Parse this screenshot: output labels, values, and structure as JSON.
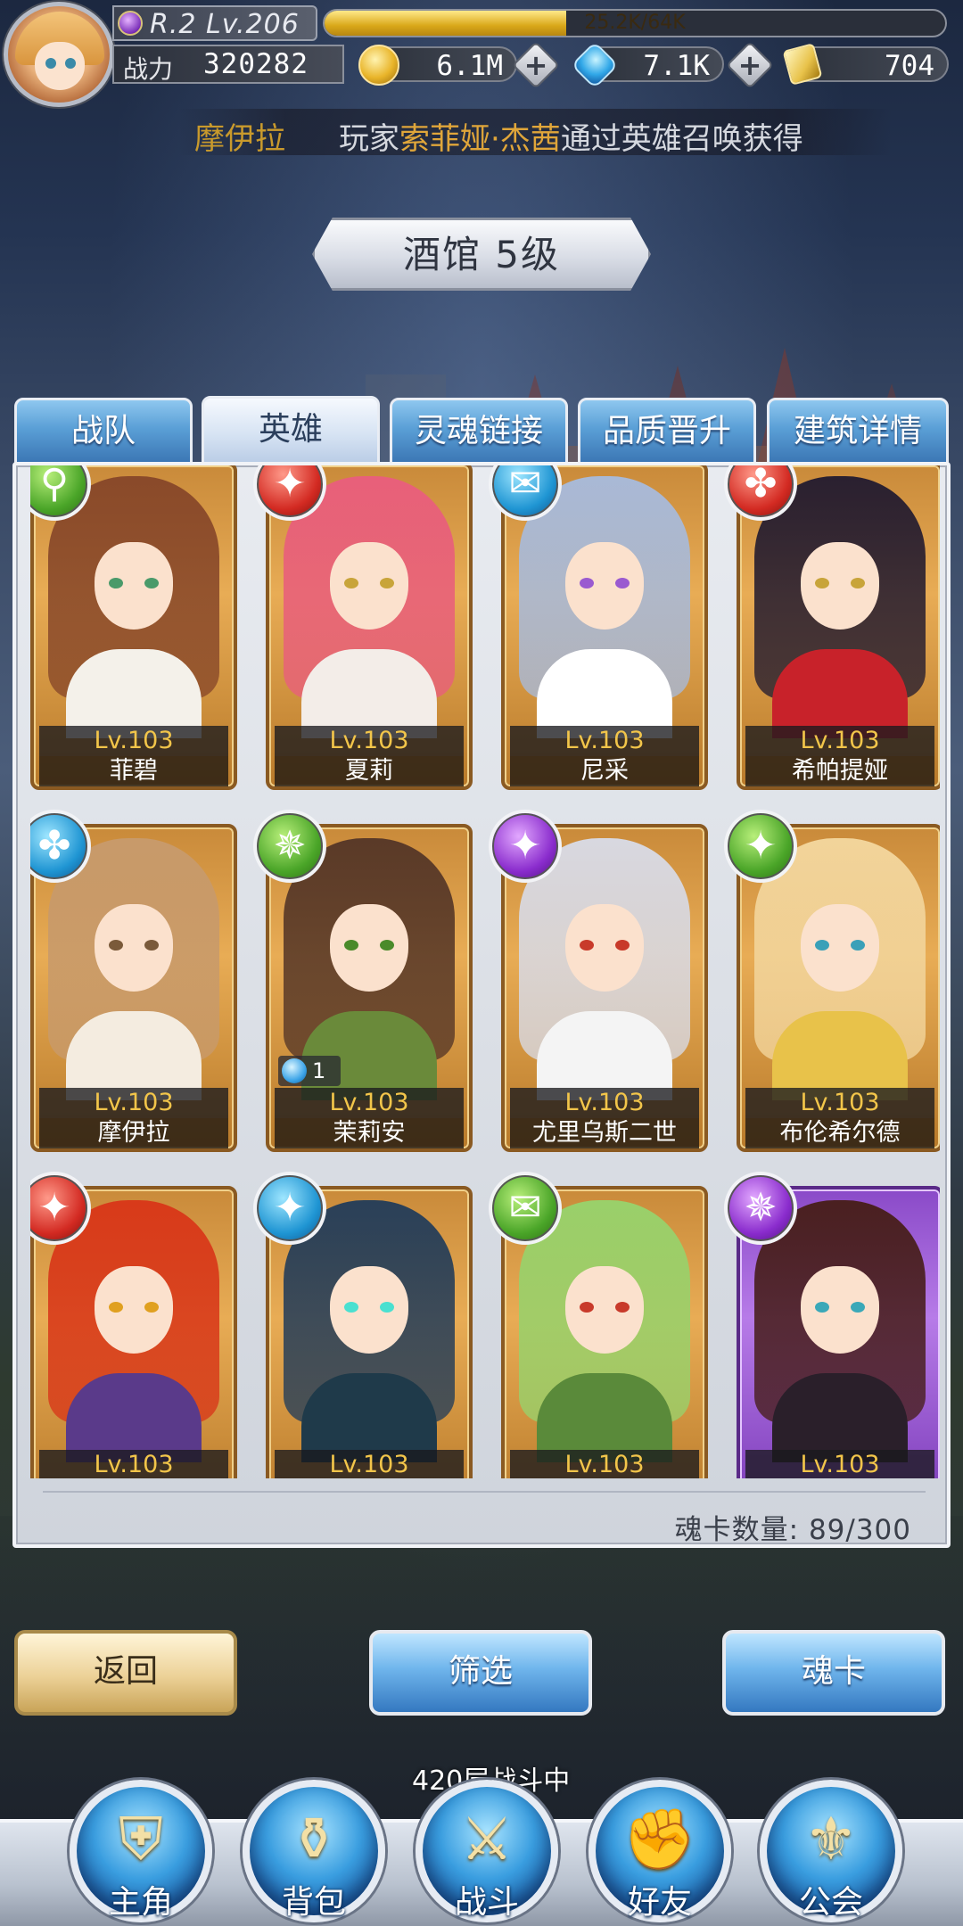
{
  "player": {
    "rank_level": "R.2 Lv.206",
    "exp_text": "25.2K/64K",
    "exp_fraction": 0.39,
    "power_label": "战力",
    "power_value": "320282"
  },
  "currencies": [
    {
      "icon": "gold-coin-icon",
      "value": "6.1M"
    },
    {
      "icon": "diamond-icon",
      "value": "7.1K"
    },
    {
      "icon": "ticket-icon",
      "value": "704"
    }
  ],
  "marquee": {
    "name": "摩伊拉",
    "text_prefix": "玩家",
    "text_highlight": "索菲娅·杰茜",
    "text_suffix": "通过英雄召唤获得"
  },
  "title": "酒馆 5级",
  "tabs": [
    "战队",
    "英雄",
    "灵魂链接",
    "品质晋升",
    "建筑详情"
  ],
  "active_tab": 1,
  "heroes": [
    {
      "name": "菲碧",
      "level": "Lv.103",
      "badge": "b-green",
      "badge_icon": "magic-staff-icon",
      "glyph": "⚲"
    },
    {
      "name": "夏莉",
      "level": "Lv.103",
      "badge": "b-red",
      "badge_icon": "sword-icon",
      "glyph": "✦"
    },
    {
      "name": "尼采",
      "level": "Lv.103",
      "badge": "b-blue",
      "badge_icon": "book-icon",
      "glyph": "✉"
    },
    {
      "name": "希帕提娅",
      "level": "Lv.103",
      "badge": "b-red",
      "badge_icon": "wings-icon",
      "glyph": "✤"
    },
    {
      "name": "摩伊拉",
      "level": "Lv.103",
      "badge": "b-blue",
      "badge_icon": "wings-icon",
      "glyph": "✤"
    },
    {
      "name": "茉莉安",
      "level": "Lv.103",
      "badge": "b-green",
      "badge_icon": "shuriken-icon",
      "glyph": "✵",
      "soul": "1"
    },
    {
      "name": "尤里乌斯二世",
      "level": "Lv.103",
      "badge": "b-purple",
      "badge_icon": "sword-icon",
      "glyph": "✦"
    },
    {
      "name": "布伦希尔德",
      "level": "Lv.103",
      "badge": "b-green",
      "badge_icon": "sword-icon",
      "glyph": "✦"
    },
    {
      "name": "",
      "level": "Lv.103",
      "badge": "b-red",
      "badge_icon": "sword-icon",
      "glyph": "✦"
    },
    {
      "name": "",
      "level": "Lv.103",
      "badge": "b-blue",
      "badge_icon": "sword-icon",
      "glyph": "✦"
    },
    {
      "name": "",
      "level": "Lv.103",
      "badge": "b-green",
      "badge_icon": "book-icon",
      "glyph": "✉"
    },
    {
      "name": "",
      "level": "Lv.103",
      "badge": "b-purple",
      "badge_icon": "shuriken-icon",
      "glyph": "✵",
      "frame": "purple"
    }
  ],
  "soul_count": "魂卡数量: 89/300",
  "buttons": {
    "back": "返回",
    "filter": "筛选",
    "soul_card": "魂卡"
  },
  "battle_status": "420层战斗中",
  "nav": [
    {
      "label": "主角",
      "icon": "helmet-icon",
      "glyph": "⛨"
    },
    {
      "label": "背包",
      "icon": "backpack-icon",
      "glyph": "⚱"
    },
    {
      "label": "战斗",
      "icon": "crossed-swords-icon",
      "glyph": "⚔"
    },
    {
      "label": "好友",
      "icon": "handshake-icon",
      "glyph": "✊"
    },
    {
      "label": "公会",
      "icon": "guild-emblem-icon",
      "glyph": "⚜"
    }
  ]
}
